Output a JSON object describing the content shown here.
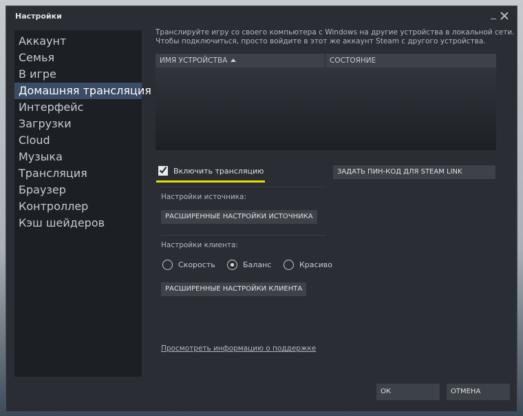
{
  "window": {
    "title": "Настройки"
  },
  "sidebar": {
    "items": [
      {
        "label": "Аккаунт"
      },
      {
        "label": "Семья"
      },
      {
        "label": "В игре"
      },
      {
        "label": "Домашняя трансляция",
        "active": true
      },
      {
        "label": "Интерфейс"
      },
      {
        "label": "Загрузки"
      },
      {
        "label": "Cloud"
      },
      {
        "label": "Музыка"
      },
      {
        "label": "Трансляция"
      },
      {
        "label": "Браузер"
      },
      {
        "label": "Контроллер"
      },
      {
        "label": "Кэш шейдеров"
      }
    ]
  },
  "content": {
    "description_line1": "Транслируйте игру со своего компьютера с Windows на другие устройства в локальной сети.",
    "description_line2": "Чтобы подключиться, просто войдите в этот же аккаунт Steam с другого устройства.",
    "table": {
      "columns": [
        "ИМЯ УСТРОЙСТВА",
        "СОСТОЯНИЕ"
      ],
      "sort_column": "ИМЯ УСТРОЙСТВА",
      "sort_direction": "ascending",
      "rows": []
    },
    "enable_streaming": {
      "label": "Включить трансляцию",
      "checked": true
    },
    "pin_button": "ЗАДАТЬ ПИН-КОД ДЛЯ STEAM LINK",
    "source_settings": {
      "label": "Настройки источника:",
      "button": "РАСШИРЕННЫЕ НАСТРОЙКИ ИСТОЧНИКА"
    },
    "client_settings": {
      "label": "Настройки клиента:",
      "options": [
        "Скорость",
        "Баланс",
        "Красиво"
      ],
      "selected": "Баланс",
      "button": "РАСШИРЕННЫЕ НАСТРОЙКИ КЛИЕНТА"
    },
    "support_link": "Просмотреть информацию о поддержке"
  },
  "footer": {
    "ok": "ОК",
    "cancel": "ОТМЕНА"
  },
  "colors": {
    "window_bg": "#2a2d33",
    "sidebar_bg": "#1c1f24",
    "active_item_bg": "#3a4c66",
    "button_bg": "#3d4148",
    "highlight_underline": "#e8e000"
  }
}
